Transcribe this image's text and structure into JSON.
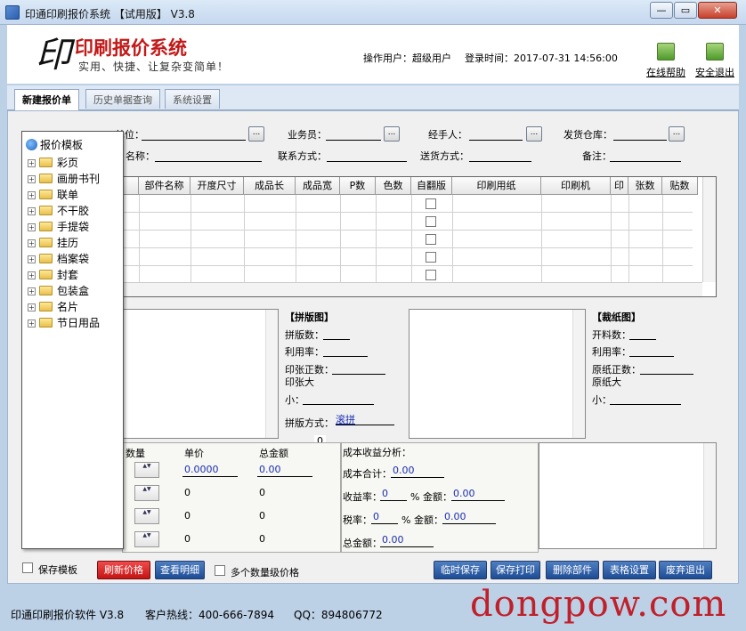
{
  "window": {
    "title": "印通印刷报价系统 【试用版】  V3.8",
    "min": "—",
    "max": "▭",
    "close": "✕"
  },
  "header": {
    "logo_mark": "印",
    "brand": "印刷报价系统",
    "slogan": "实用、快捷、让复杂变简单！",
    "operator": "操作用户：超级用户",
    "login_time": "登录时间：2017-07-31 14:56:00",
    "help": "在线帮助",
    "exit": "安全退出"
  },
  "tabs": [
    "新建报价单",
    "历史单据查询",
    "系统设置"
  ],
  "tree": {
    "root": "报价模板",
    "items": [
      "彩页",
      "画册书刊",
      "联单",
      "不干胶",
      "手提袋",
      "挂历",
      "档案袋",
      "封套",
      "包装盒",
      "名片",
      "节日用品"
    ]
  },
  "form": {
    "customer_unit": "单位：",
    "salesman": "业务员：",
    "handler": "经手人：",
    "shipping_warehouse": "发货仓库：",
    "product_name": "名称：",
    "contact": "联系方式：",
    "delivery": "送货方式：",
    "remark": "备注："
  },
  "grid": {
    "headers": [
      "部件名称",
      "开度尺寸",
      "成品长",
      "成品宽",
      "P数",
      "色数",
      "自翻版",
      "印刷用纸",
      "印刷机",
      "印",
      "张数",
      "贴数"
    ]
  },
  "imposition": {
    "title": "【拼版图】",
    "count": "拼版数：",
    "rate": "利用率：",
    "front": "印张正数：",
    "size": "印张大",
    "small": "小：",
    "method": "拼版方式：",
    "method_value": "滚拼",
    "zero": "0"
  },
  "cutting": {
    "title": "【裁纸图】",
    "count": "开料数：",
    "rate": "利用率：",
    "front": "原纸正数：",
    "size": "原纸大",
    "small": "小："
  },
  "price": {
    "qty": "数量",
    "unit_price": "单价",
    "total": "总金额",
    "rows": [
      {
        "unit": "0.0000",
        "total": "0.00"
      },
      {
        "unit": "0",
        "total": "0"
      },
      {
        "unit": "0",
        "total": "0"
      },
      {
        "unit": "0",
        "total": "0"
      }
    ]
  },
  "cost": {
    "title": "成本收益分析：",
    "cost_total": "成本合计：",
    "cost_total_val": "0.00",
    "profit_rate": "收益率：",
    "profit_rate_val": "0",
    "amount": "% 金额：",
    "amount_val": "0.00",
    "tax_rate": "税率：",
    "tax_rate_val": "0",
    "tax_amount_val": "0.00",
    "grand": "总金额：",
    "grand_val": "0.00"
  },
  "bottom": {
    "save_template": "保存模板",
    "refresh_price": "刷新价格",
    "view_detail": "查看明细",
    "multi_qty": "多个数量级价格",
    "temp_save": "临时保存",
    "save_print": "保存打印",
    "delete_part": "删除部件",
    "table_settings": "表格设置",
    "discard_exit": "废弃退出"
  },
  "status": {
    "software": "印通印刷报价软件 V3.8",
    "hotline": "客户热线：400-666-7894",
    "qq": "QQ：894806772",
    "watermark": "dongpow.com"
  },
  "colors": {
    "red_button": "#d81c1c",
    "blue_button": "#1d4c95",
    "brand_red": "#c21818"
  }
}
